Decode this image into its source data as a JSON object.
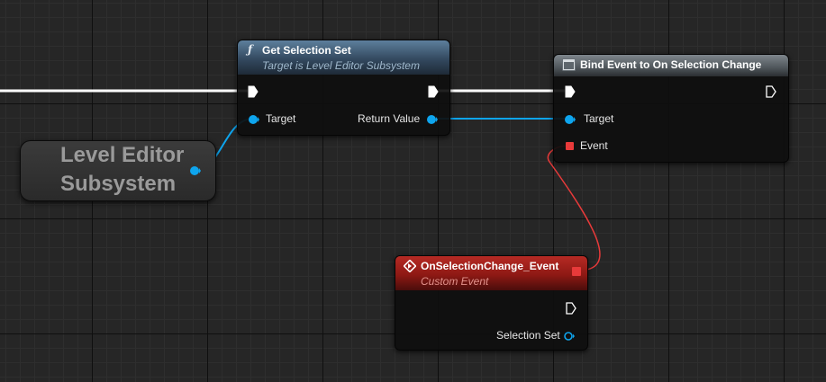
{
  "nodes": {
    "get_selection_set": {
      "title": "Get Selection Set",
      "subtitle": "Target is Level Editor Subsystem",
      "header_icon": "function-icon",
      "pins": {
        "target": "Target",
        "return_value": "Return Value"
      }
    },
    "bind_event": {
      "title": "Bind Event to On Selection Change",
      "header_icon": "delegate-icon",
      "pins": {
        "target": "Target",
        "event": "Event"
      }
    },
    "custom_event": {
      "title": "OnSelectionChange_Event",
      "subtitle": "Custom Event",
      "header_icon": "event-diamond-icon",
      "pins": {
        "selection_set": "Selection Set"
      }
    },
    "level_editor_subsystem": {
      "label": "Level Editor\nSubsystem"
    }
  },
  "colors": {
    "exec_wire": "#ffffff",
    "object_pin": "#0ea5ee",
    "delegate_pin": "#e83a3a",
    "event_subtitle": "#e3928c",
    "function_subtitle": "#9fb8cc"
  }
}
